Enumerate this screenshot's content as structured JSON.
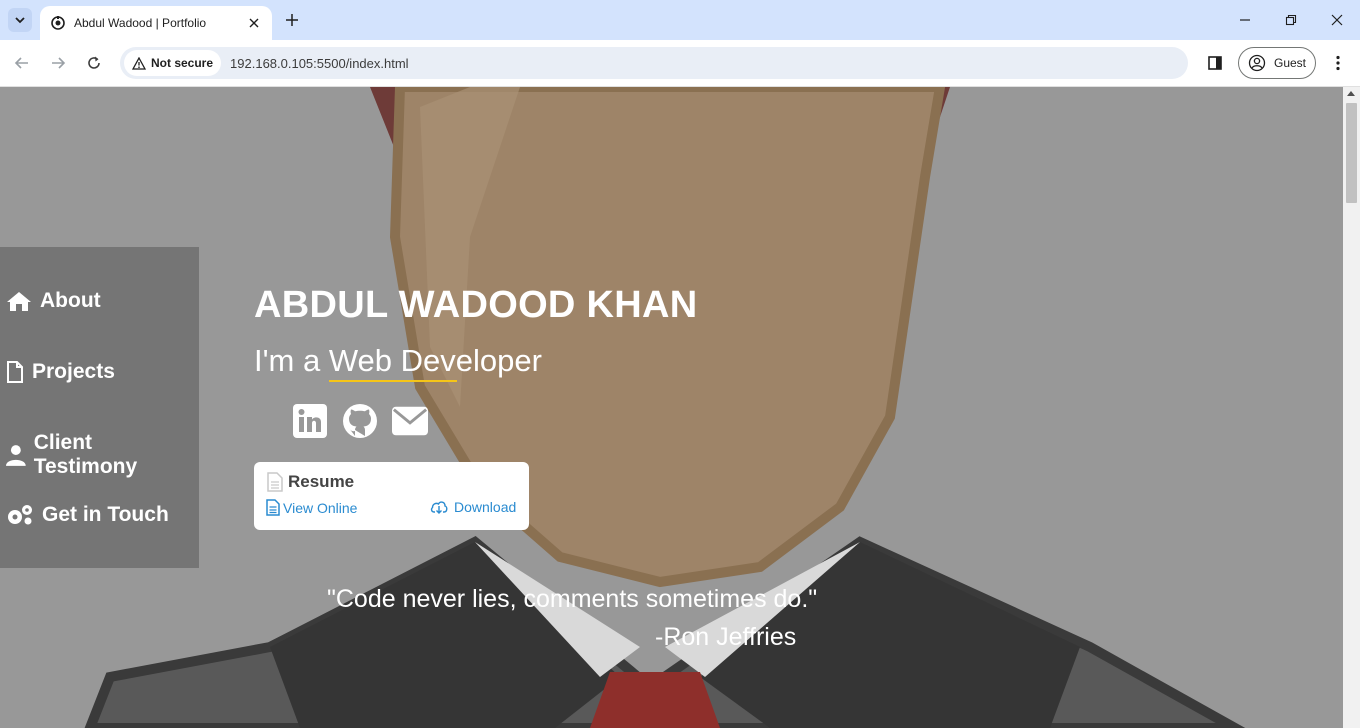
{
  "browser": {
    "tab_title": "Abdul Wadood | Portfolio",
    "security_label": "Not secure",
    "url": "192.168.0.105:5500/index.html",
    "profile_label": "Guest"
  },
  "sidebar": {
    "items": [
      {
        "label": "About",
        "icon": "home-icon"
      },
      {
        "label": "Projects",
        "icon": "file-icon"
      },
      {
        "label": "Client Testimony",
        "icon": "user-icon"
      },
      {
        "label": "Get in Touch",
        "icon": "gears-icon"
      }
    ]
  },
  "hero": {
    "name": "ABDUL WADOOD KHAN",
    "role_prefix": "I'm a ",
    "role_typed": "Web Developer",
    "socials": [
      "linkedin-icon",
      "github-icon",
      "envelope-icon"
    ]
  },
  "resume": {
    "title": "Resume",
    "view_label": "View Online",
    "download_label": "Download"
  },
  "quote": {
    "text": "\"Code never lies, comments sometimes do.\"",
    "author": "-Ron Jeffries"
  },
  "colors": {
    "accent_underline": "#f5c518",
    "link_blue": "#2a8bd0",
    "sidebar_bg": "#757575",
    "page_overlay": "#989898"
  }
}
